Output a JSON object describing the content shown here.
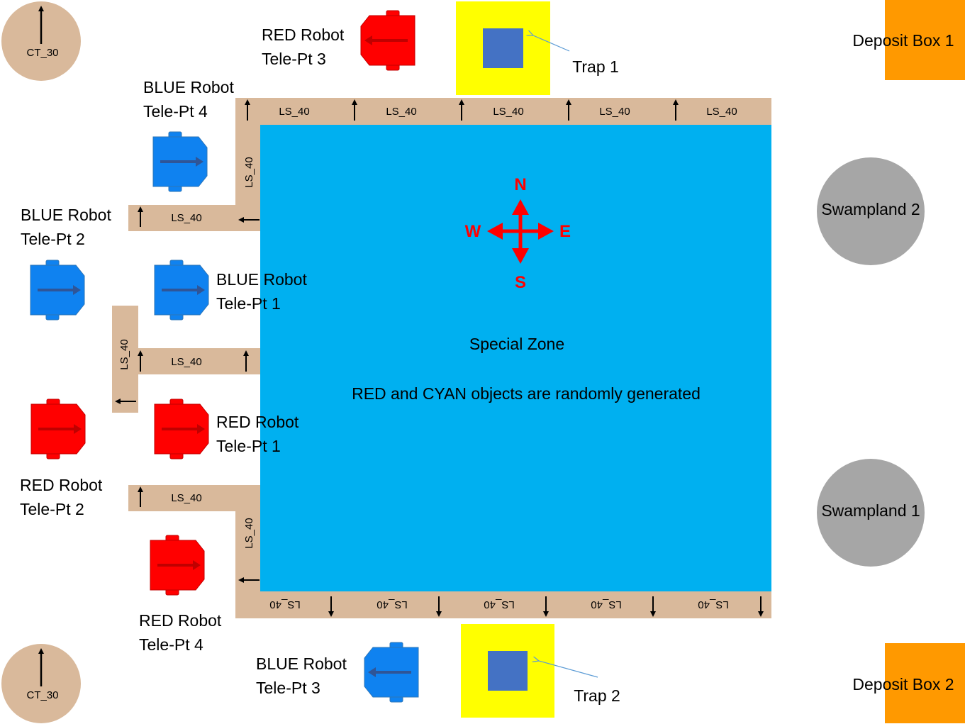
{
  "colors": {
    "field": "#00B0F0",
    "track": "#D9B99B",
    "trap_outer": "#FFFF00",
    "trap_inner": "#4472C4",
    "deposit": "#FF9900",
    "swamp": "#A6A6A6",
    "checkpoint": "#D9B99B",
    "red_robot": "#FF0000",
    "blue_robot": "#0F82F0",
    "compass": "#FF0000"
  },
  "checkpoints": [
    {
      "label": "CT_30",
      "icon": "up-arrow-icon"
    },
    {
      "label": "CT_30",
      "icon": "up-arrow-icon"
    }
  ],
  "track_label": "LS_40",
  "compass": {
    "n": "N",
    "s": "S",
    "e": "E",
    "w": "W"
  },
  "special_zone": {
    "title": "Special Zone",
    "note": "RED and CYAN objects are randomly generated"
  },
  "traps": [
    {
      "label": "Trap 1"
    },
    {
      "label": "Trap 2"
    }
  ],
  "deposit_boxes": [
    {
      "label": "Deposit Box 1"
    },
    {
      "label": "Deposit Box 2"
    }
  ],
  "swamplands": [
    {
      "label": "Swampland 2"
    },
    {
      "label": "Swampland 1"
    }
  ],
  "robots": {
    "red_3": [
      "RED Robot",
      "Tele-Pt 3"
    ],
    "blue_4": [
      "BLUE Robot",
      "Tele-Pt 4"
    ],
    "blue_2": [
      "BLUE Robot",
      "Tele-Pt 2"
    ],
    "blue_1": [
      "BLUE Robot",
      "Tele-Pt 1"
    ],
    "red_1": [
      "RED Robot",
      "Tele-Pt 1"
    ],
    "red_2": [
      "RED Robot",
      "Tele-Pt 2"
    ],
    "red_4": [
      "RED Robot",
      "Tele-Pt 4"
    ],
    "blue_3": [
      "BLUE Robot",
      "Tele-Pt 3"
    ]
  }
}
